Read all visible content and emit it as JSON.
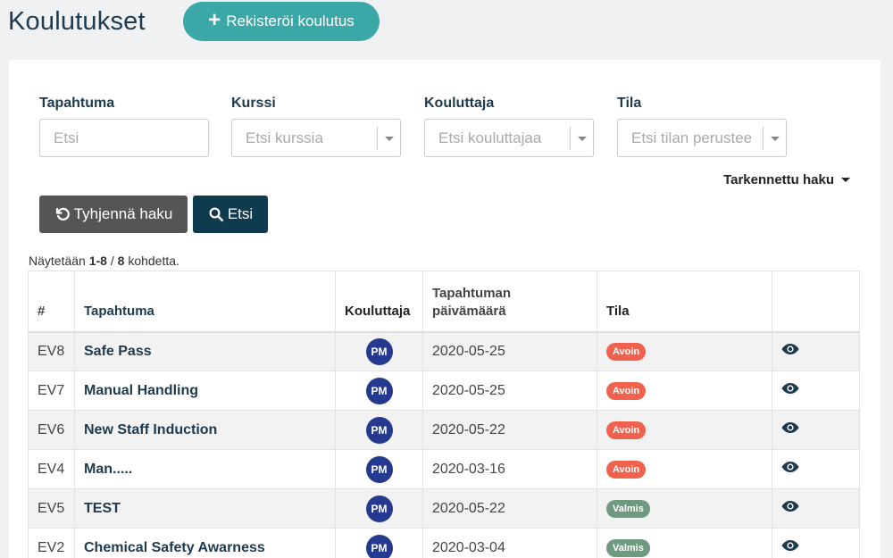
{
  "header": {
    "title": "Koulutukset",
    "register_label": "Rekisteröi koulutus"
  },
  "filters": [
    {
      "label": "Tapahtuma",
      "placeholder": "Etsi",
      "type": "text"
    },
    {
      "label": "Kurssi",
      "placeholder": "Etsi kurssia",
      "type": "select"
    },
    {
      "label": "Kouluttaja",
      "placeholder": "Etsi kouluttajaa",
      "type": "select"
    },
    {
      "label": "Tila",
      "placeholder": "Etsi tilan perusteella",
      "type": "select"
    }
  ],
  "advanced_search_label": "Tarkennettu haku",
  "buttons": {
    "reset_label": "Tyhjennä haku",
    "search_label": "Etsi"
  },
  "summary": {
    "prefix": "Näytetään",
    "range": "1-8",
    "separator": "/",
    "total": "8",
    "suffix": "kohdetta."
  },
  "table": {
    "headers": [
      "#",
      "Tapahtuma",
      "Kouluttaja",
      "Tapahtuman päivämäärä",
      "Tila",
      ""
    ],
    "rows": [
      {
        "id": "EV8",
        "event": "Safe Pass",
        "trainer": "PM",
        "date": "2020-05-25",
        "status": "Avoin"
      },
      {
        "id": "EV7",
        "event": "Manual Handling",
        "trainer": "PM",
        "date": "2020-05-25",
        "status": "Avoin"
      },
      {
        "id": "EV6",
        "event": "New Staff Induction",
        "trainer": "PM",
        "date": "2020-05-22",
        "status": "Avoin"
      },
      {
        "id": "EV4",
        "event": "Man.....",
        "trainer": "PM",
        "date": "2020-03-16",
        "status": "Avoin"
      },
      {
        "id": "EV5",
        "event": "TEST",
        "trainer": "PM",
        "date": "2020-05-22",
        "status": "Valmis"
      },
      {
        "id": "EV2",
        "event": "Chemical Safety Awarness",
        "trainer": "PM",
        "date": "2020-03-04",
        "status": "Valmis"
      }
    ]
  },
  "colors": {
    "accent": "#3ba7a6",
    "primary_dark": "#0f3b4e",
    "reset_button": "#555555",
    "avatar": "#253a8f",
    "status_open": "#f0624d",
    "status_done": "#6f9a7f"
  },
  "icons": {
    "plus": "plus-icon",
    "reset": "undo-icon",
    "search": "search-icon",
    "view": "eye-icon"
  }
}
